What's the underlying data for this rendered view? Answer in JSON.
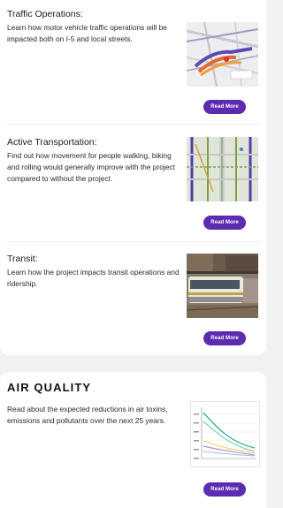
{
  "sections": [
    {
      "title": "Traffic Operations:",
      "description": "Learn how motor vehicle traffic operations will be impacted both on I-5 and local streets.",
      "button_label": "Read More",
      "thumbnail": "map-traffic-icon"
    },
    {
      "title": "Active Transportation:",
      "description": "Find out how movement for people walking, biking and rolling would generally improve with the project compared to without the project.",
      "button_label": "Read More",
      "thumbnail": "map-active-transportation-icon"
    },
    {
      "title": "Transit:",
      "description": "Learn how the project impacts transit operations and ridership.",
      "button_label": "Read More",
      "thumbnail": "train-photo-icon"
    }
  ],
  "air_quality": {
    "heading": "AIR QUALITY",
    "description": "Read about the expected reductions in air toxins, emissions and pollutants over the next 25 years.",
    "button_label": "Read More",
    "thumbnail": "line-chart-icon"
  },
  "colors": {
    "button": "#5b2bb0",
    "page_background": "#f1f1f2",
    "card_background": "#ffffff"
  }
}
